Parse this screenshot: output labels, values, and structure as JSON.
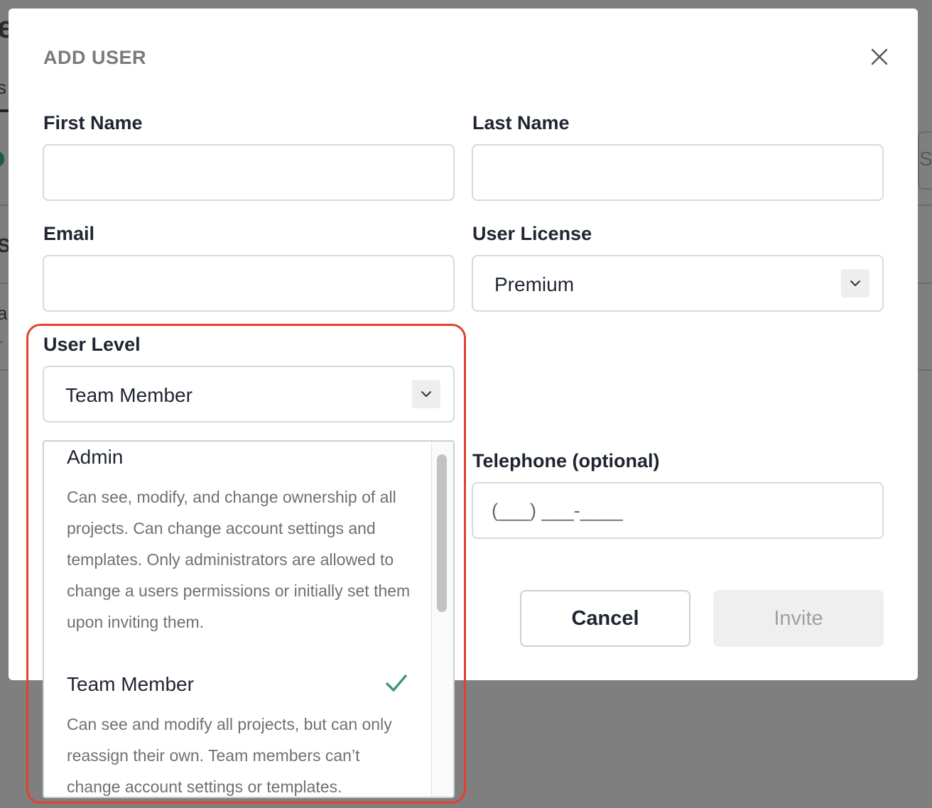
{
  "modal": {
    "title": "ADD USER",
    "close_icon": "close-icon"
  },
  "fields": {
    "first_name": {
      "label": "First Name",
      "value": ""
    },
    "last_name": {
      "label": "Last Name",
      "value": ""
    },
    "email": {
      "label": "Email",
      "value": ""
    },
    "user_license": {
      "label": "User License",
      "value": "Premium"
    },
    "user_level": {
      "label": "User Level",
      "value": "Team Member"
    },
    "telephone": {
      "label": "Telephone (optional)",
      "placeholder": "(___) ___-____"
    }
  },
  "user_level_options": [
    {
      "title": "Admin",
      "description": "Can see, modify, and change ownership of all projects. Can change account settings and templates. Only administrators are allowed to change a users permissions or initially set them upon inviting them.",
      "selected": false
    },
    {
      "title": "Team Member",
      "description": "Can see and modify all projects, but can only reassign their own. Team members can’t change account settings or templates.",
      "selected": true
    }
  ],
  "buttons": {
    "cancel": "Cancel",
    "invite": "Invite"
  },
  "colors": {
    "highlight": "#e4412f",
    "check": "#3a9a6e",
    "overlay": "#7f7f7f"
  }
}
